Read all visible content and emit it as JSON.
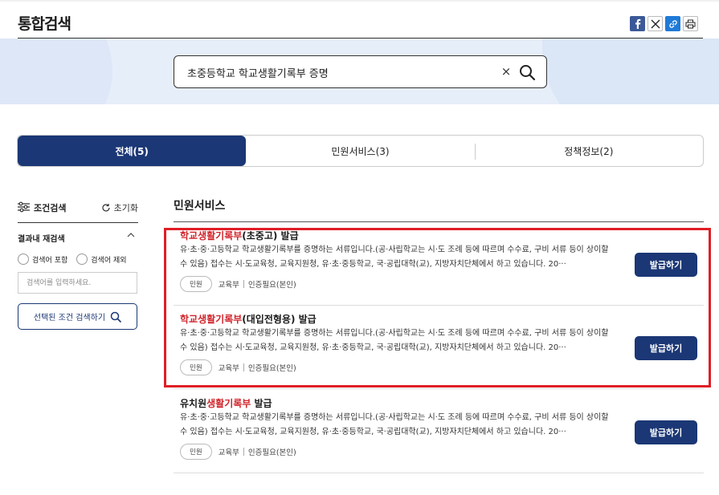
{
  "header": {
    "title": "통합검색",
    "share_buttons": [
      "facebook-icon",
      "x-icon",
      "link-icon",
      "print-icon"
    ]
  },
  "search": {
    "value": "초중등학교 학교생활기록부 증명",
    "clear_symbol": "×"
  },
  "tabs": [
    {
      "label": "전체(5)",
      "active": true
    },
    {
      "label": "민원서비스(3)",
      "active": false
    },
    {
      "label": "정책정보(2)",
      "active": false
    }
  ],
  "sidebar": {
    "filter_title": "조건검색",
    "reset_label": "초기화",
    "refine_title": "결과내 재검색",
    "radio_include": "검색어 포함",
    "radio_exclude": "검색어 제외",
    "refine_placeholder": "검색어를 입력하세요.",
    "search_button": "선택된 조건 검색하기"
  },
  "main": {
    "section_title": "민원서비스",
    "results": [
      {
        "title_hl": "학교생활기록부",
        "title_pre": "",
        "title_rest": "(초중고) 발급",
        "desc": "유·초·중·고등학교 학교생활기록부를 증명하는 서류입니다.(공·사립학교는 시·도 조례 등에 따르며 수수료, 구비 서류 등이 상이할 수 있음) 접수는 시·도교육청, 교육지원청, 유·초·중등학교, 국·공립대학(교), 지방자치단체에서 하고 있습니다. 20···",
        "badge": "민원",
        "org": "교육부",
        "auth": "인증필요(본인)",
        "button": "발급하기"
      },
      {
        "title_hl": "학교생활기록부",
        "title_pre": "",
        "title_rest": "(대입전형용) 발급",
        "desc": "유·초·중·고등학교 학교생활기록부를 증명하는 서류입니다.(공·사립학교는 시·도 조례 등에 따르며 수수료, 구비 서류 등이 상이할 수 있음) 접수는 시·도교육청, 교육지원청, 유·초·중등학교, 국·공립대학(교), 지방자치단체에서 하고 있습니다. 20···",
        "badge": "민원",
        "org": "교육부",
        "auth": "인증필요(본인)",
        "button": "발급하기"
      },
      {
        "title_pre": "유치원",
        "title_hl": "생활기록부",
        "title_rest": " 발급",
        "desc": "유·초·중·고등학교 학교생활기록부를 증명하는 서류입니다.(공·사립학교는 시·도 조례 등에 따르며 수수료, 구비 서류 등이 상이할 수 있음) 접수는 시·도교육청, 교육지원청, 유·초·중등학교, 국·공립대학(교), 지방자치단체에서 하고 있습니다. 20···",
        "badge": "민원",
        "org": "교육부",
        "auth": "인증필요(본인)",
        "button": "발급하기"
      }
    ]
  },
  "colors": {
    "primary": "#1b3775",
    "highlight_text": "#d0242b",
    "annotation_box": "#e01e26",
    "banner_bg": "#e6eefa"
  }
}
